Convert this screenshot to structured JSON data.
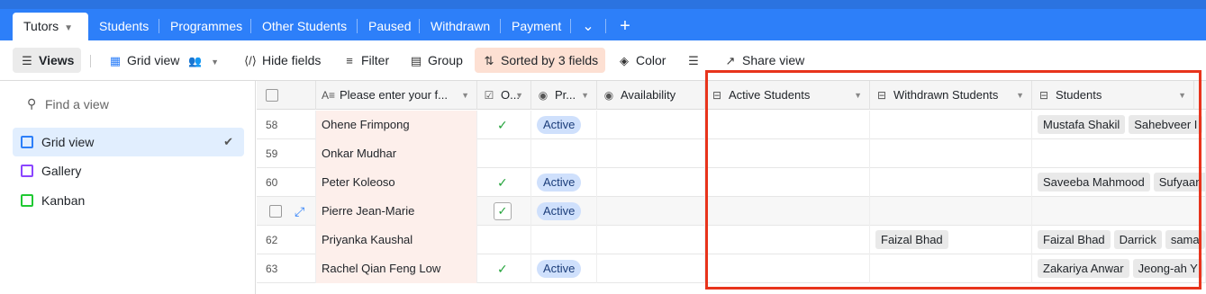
{
  "tabs": [
    {
      "label": "Tutors",
      "active": true
    },
    {
      "label": "Students"
    },
    {
      "label": "Programmes"
    },
    {
      "label": "Other Students"
    },
    {
      "label": "Paused"
    },
    {
      "label": "Withdrawn"
    },
    {
      "label": "Payment"
    }
  ],
  "tab_icons": {
    "more": "chevron-down-icon",
    "add": "plus-icon"
  },
  "toolbar": {
    "views": "Views",
    "grid_view": "Grid view",
    "hide_fields": "Hide fields",
    "filter": "Filter",
    "group": "Group",
    "sorted": "Sorted by 3 fields",
    "color": "Color",
    "share": "Share view"
  },
  "sidebar": {
    "find_placeholder": "Find a view",
    "views": [
      {
        "label": "Grid view",
        "selected": true,
        "color": "#2d7ff9"
      },
      {
        "label": "Gallery",
        "color": "#8b46ff"
      },
      {
        "label": "Kanban",
        "color": "#20c933"
      }
    ]
  },
  "columns": {
    "name": "Please enter your f...",
    "o": "O...",
    "pr": "Pr...",
    "availability": "Availability",
    "active_students": "Active Students",
    "withdrawn_students": "Withdrawn Students",
    "students": "Students"
  },
  "rows": [
    {
      "num": "58",
      "name": "Ohene Frimpong",
      "check": true,
      "status": "Active",
      "withdrawn": [],
      "students": [
        "Mustafa Shakil",
        "Sahebveer I"
      ]
    },
    {
      "num": "59",
      "name": "Onkar Mudhar",
      "check": false,
      "status": "",
      "withdrawn": [],
      "students": []
    },
    {
      "num": "60",
      "name": "Peter Koleoso",
      "check": true,
      "status": "Active",
      "withdrawn": [],
      "students": [
        "Saveeba Mahmood",
        "Sufyaan"
      ]
    },
    {
      "num": "",
      "name": "Pierre Jean-Marie",
      "check": true,
      "status": "Active",
      "withdrawn": [],
      "students": [],
      "hover": true
    },
    {
      "num": "62",
      "name": "Priyanka Kaushal",
      "check": false,
      "status": "",
      "withdrawn": [
        "Faizal Bhad"
      ],
      "students": [
        "Faizal Bhad",
        "Darrick",
        "sama"
      ]
    },
    {
      "num": "63",
      "name": "Rachel Qian Feng Low",
      "check": true,
      "status": "Active",
      "withdrawn": [],
      "students": [
        "Zakariya Anwar",
        "Jeong-ah Y"
      ]
    }
  ],
  "colors": {
    "tabbar": "#2d7ff9",
    "highlight_box": "#e8341c",
    "name_column": "#fdefeb",
    "status_pill": "#cfe0fc"
  }
}
